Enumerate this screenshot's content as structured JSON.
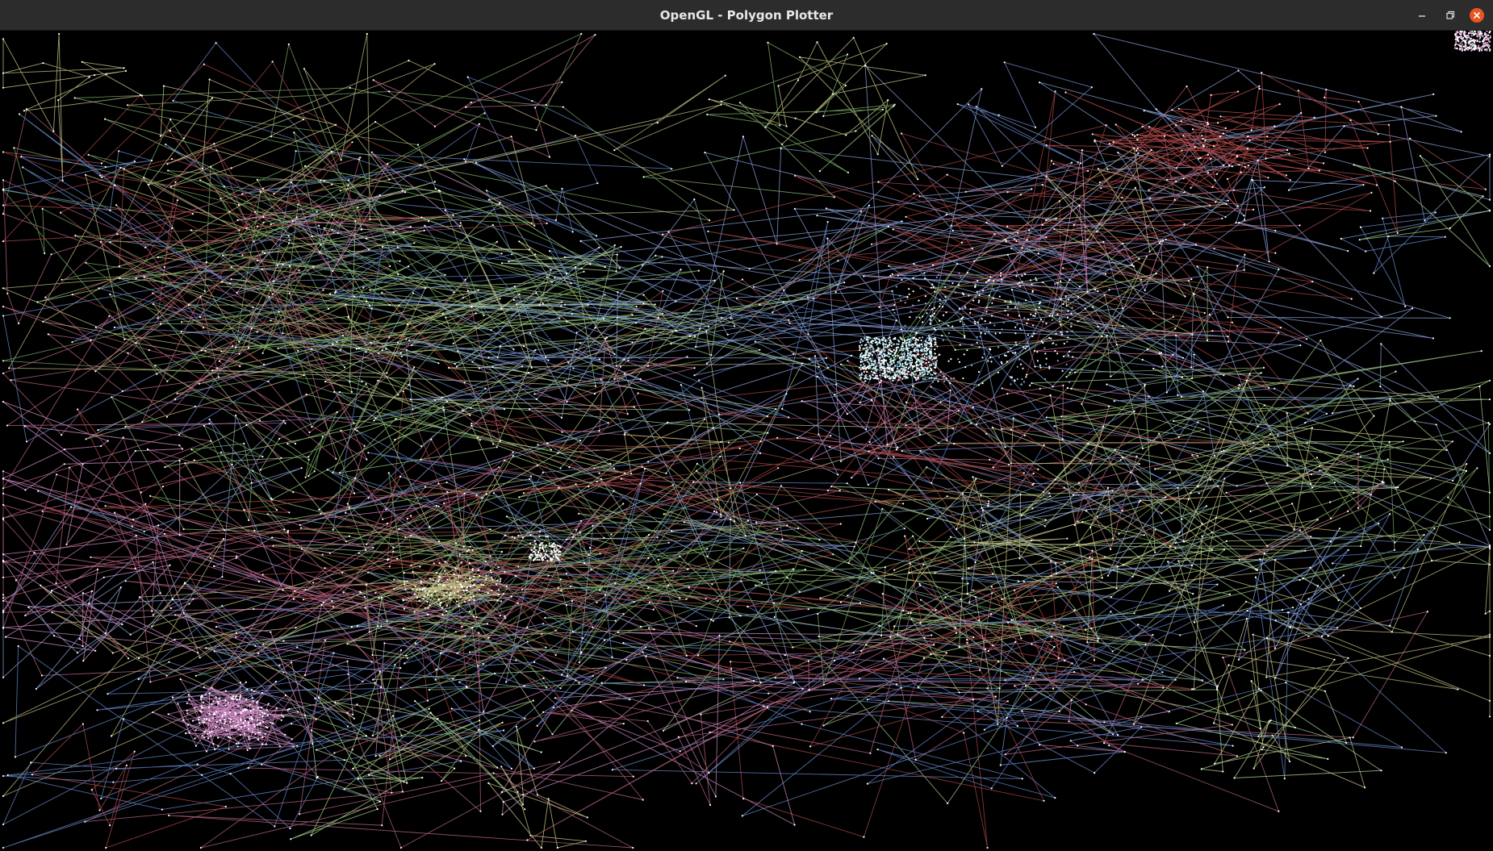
{
  "window": {
    "title": "OpenGL - Polygon Plotter",
    "controls": {
      "minimize_icon": "minimize-icon",
      "maximize_icon": "restore-icon",
      "close_icon": "close-icon",
      "close_color": "#e95420"
    }
  },
  "canvas": {
    "background": "#000000",
    "vertex_color": "#ffffff",
    "polygon_colors": [
      "#7fb069",
      "#6b8fd6",
      "#c06a8a",
      "#c9c58a",
      "#a9d18e",
      "#b24a4a",
      "#8fa7e0",
      "#d38fc9"
    ]
  }
}
